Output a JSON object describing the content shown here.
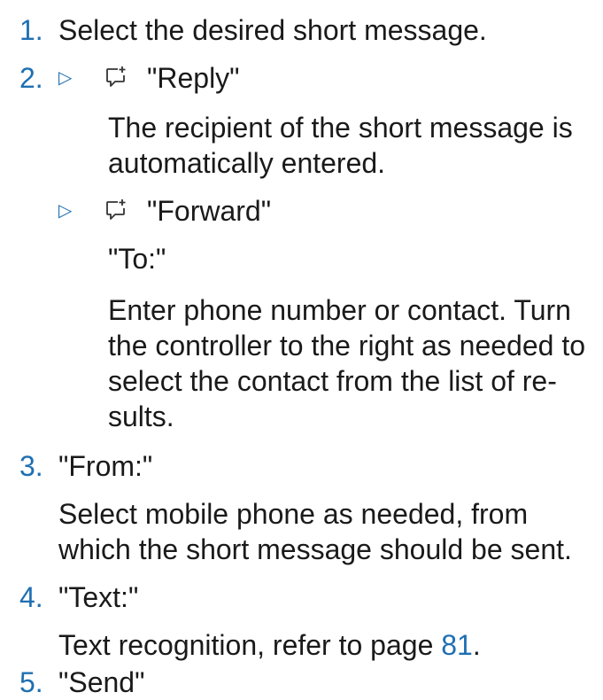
{
  "steps": [
    {
      "number": "1.",
      "text": "Select the desired short message."
    },
    {
      "number": "2.",
      "reply": {
        "arrow": "▷",
        "icon": "message-new-icon",
        "label": "\"Reply\"",
        "desc": [
          "The recipient of the short message is",
          "automatically entered."
        ]
      },
      "forward": {
        "arrow": "▷",
        "icon": "message-new-icon",
        "label": "\"Forward\"",
        "to": "\"To:\"",
        "desc": [
          "Enter phone number or contact. Turn",
          "the controller to the right as needed to",
          "select the contact from the list of re-",
          "sults."
        ]
      }
    },
    {
      "number": "3.",
      "label": "\"From:\"",
      "desc": [
        "Select mobile phone as needed, from",
        "which the short message should be sent."
      ]
    },
    {
      "number": "4.",
      "label": "\"Text:\"",
      "desc_prefix": "Text recognition, refer to page ",
      "page_ref": "81",
      "desc_suffix": "."
    },
    {
      "number": "5.",
      "label": "\"Send\""
    }
  ],
  "colors": {
    "accent": "#1f6fb2",
    "text": "#1a1a1a"
  }
}
